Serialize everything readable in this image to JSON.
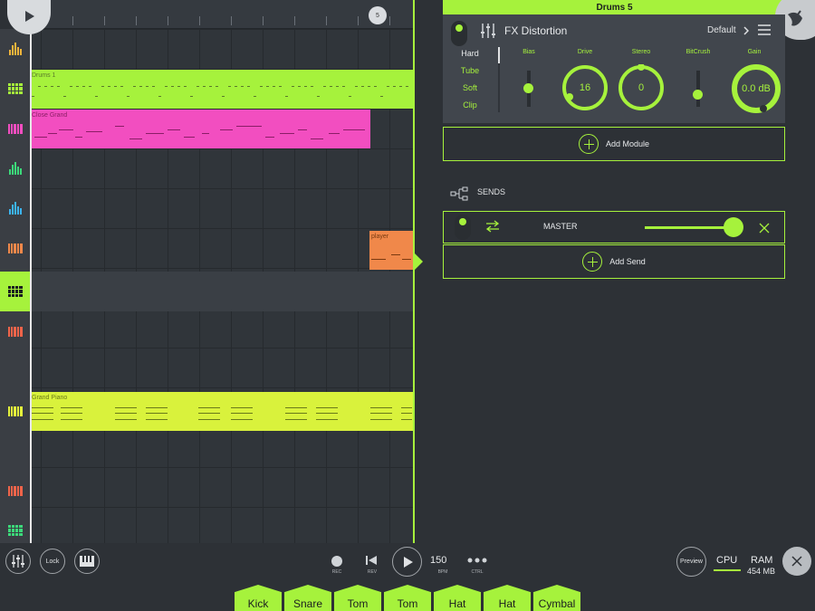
{
  "colors": {
    "accent": "#a6f23c",
    "pink": "#f24ec0",
    "yellow": "#d9f23c",
    "orange": "#f0884a",
    "panel": "#41464d",
    "background": "#2d3136"
  },
  "timeline": {
    "marker": "5",
    "clips": [
      {
        "name": "Drums 1"
      },
      {
        "name": "Close Grand"
      },
      {
        "name": "player"
      },
      {
        "name": "Grand Piano"
      }
    ]
  },
  "track_icons": [
    {
      "icon": "drum-bars-icon",
      "color": "#f0b43c"
    },
    {
      "icon": "drum-pads-icon",
      "color": "#a6f23c"
    },
    {
      "icon": "piano-keys-icon",
      "color": "#f24ec0"
    },
    {
      "icon": "drum-bars-icon",
      "color": "#3cd97a"
    },
    {
      "icon": "drum-bars-icon",
      "color": "#3cb4f0"
    },
    {
      "icon": "piano-keys-icon",
      "color": "#f0884a"
    },
    {
      "icon": "drum-pads-icon",
      "color": "#1b1e20",
      "active": true
    },
    {
      "icon": "piano-keys-icon",
      "color": "#f0644a"
    },
    {
      "icon": "piano-keys-icon",
      "color": "#e4f23c"
    },
    {
      "icon": "piano-keys-icon",
      "color": "#f0644a"
    },
    {
      "icon": "drum-pads-icon",
      "color": "#3cd97a"
    }
  ],
  "fx_panel": {
    "header": "Drums 5",
    "module_title": "FX Distortion",
    "preset": "Default",
    "modes": [
      {
        "label": "Hard",
        "selected": true
      },
      {
        "label": "Tube",
        "selected": false
      },
      {
        "label": "Soft",
        "selected": false
      },
      {
        "label": "Clip",
        "selected": false
      }
    ],
    "params": {
      "bias": {
        "label": "Bias"
      },
      "drive": {
        "label": "Drive",
        "value": "16"
      },
      "stereo": {
        "label": "Stereo",
        "value": "0"
      },
      "bitcrush": {
        "label": "BitCrush"
      },
      "gain": {
        "label": "Gain",
        "value": "0.0 dB"
      }
    },
    "add_module": "Add Module"
  },
  "sends": {
    "title": "SENDS",
    "send_name": "MASTER",
    "add_send": "Add Send"
  },
  "transport": {
    "lock": "Lock",
    "rec": "REC",
    "rev": "REV",
    "bpm_value": "150",
    "bpm_label": "BPM",
    "ctrl": "CTRL",
    "preview": "Preview",
    "cpu": "CPU",
    "ram": "RAM",
    "ram_value": "454 MB"
  },
  "pads": [
    "Kick",
    "Snare",
    "Tom",
    "Tom",
    "Hat",
    "Hat",
    "Cymbal"
  ]
}
